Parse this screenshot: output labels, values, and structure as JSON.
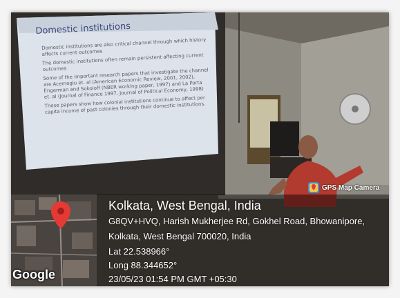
{
  "slide": {
    "title": "Domestic institutions",
    "bullets": [
      "Domestic institutions are also critical channel through which history affects current outcomes",
      "The domestic institutions often remain persistent affecting current outcomes",
      "Some of the important research papers that investigate the channel are Acemoglu et. al (American Economic Review, 2001, 2002), Engerman and Sokoloff (NBER working paper, 1997) and La Porta et. al (Journal of Finance 1997, Journal of Political Economy, 1998)",
      "These papers show how colonial institutions continue to affect per capita income of past colonies through their domestic institutions."
    ]
  },
  "map": {
    "logo_text": "Google"
  },
  "badge": {
    "label": "GPS Map Camera"
  },
  "location": {
    "title": "Kolkata, West Bengal, India",
    "address_line1": "G8QV+HVQ, Harish Mukherjee Rd, Gokhel Road, Bhowanipore,",
    "address_line2": "Kolkata, West Bengal 700020, India",
    "latitude": "Lat 22.538966°",
    "longitude": "Long 88.344652°",
    "timestamp": "23/05/23 01:54 PM GMT +05:30"
  },
  "colors": {
    "pin": "#e53935",
    "overlay": "#000000"
  }
}
